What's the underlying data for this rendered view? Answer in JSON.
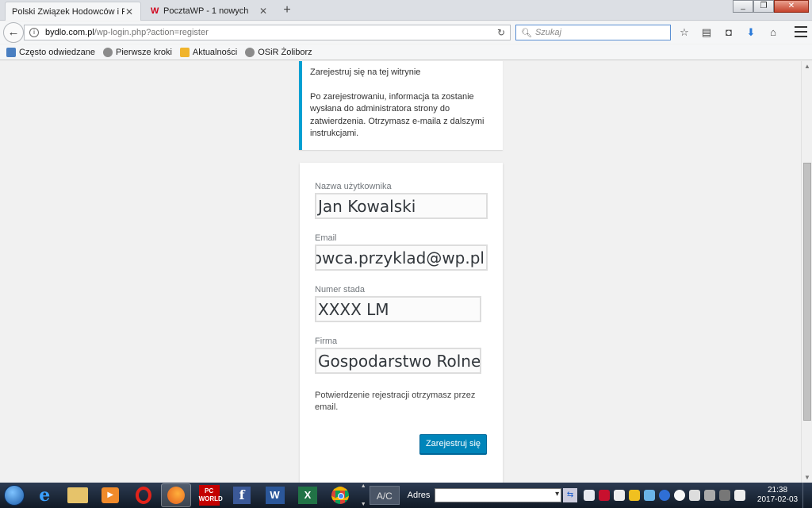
{
  "browser": {
    "tabs": [
      {
        "label": "Polski Związek Hodowców i Pr...",
        "active": true
      },
      {
        "label": "PocztaWP - 1 nowych",
        "active": false
      }
    ],
    "window_controls": [
      "_",
      "❐",
      "✕"
    ],
    "url_host": "bydlo.com.pl",
    "url_path": "/wp-login.php?action=register",
    "search_placeholder": "Szukaj",
    "bookmarks": [
      "Często odwiedzane",
      "Pierwsze kroki",
      "Aktualności",
      "OSiR Żoliborz"
    ]
  },
  "message": {
    "line1": "Zarejestruj się na tej witrynie",
    "line2": "Po zarejestrowaniu, informacja ta zostanie wysłana do administratora strony do zatwierdzenia. Otrzymasz e-maila z dalszymi instrukcjami."
  },
  "form": {
    "username_label": "Nazwa użytkownika",
    "username_value": "Jan Kowalski",
    "email_label": "Email",
    "email_value": "hodowca.przyklad@wp.pl",
    "herd_label": "Numer stada",
    "herd_value": "XXXX LM",
    "company_label": "Firma",
    "company_value": "Gospodarstwo Rolne",
    "note": "Potwierdzenie rejestracji otrzymasz przez email.",
    "submit_label": "Zarejestruj się"
  },
  "taskbar": {
    "pcworld_label": "PC WORLD",
    "ac_label": "A/C",
    "adres_label": "Adres",
    "time": "21:38",
    "date": "2017-02-03"
  },
  "colors": {
    "accent": "#00a0d2",
    "button": "#0085ba"
  }
}
